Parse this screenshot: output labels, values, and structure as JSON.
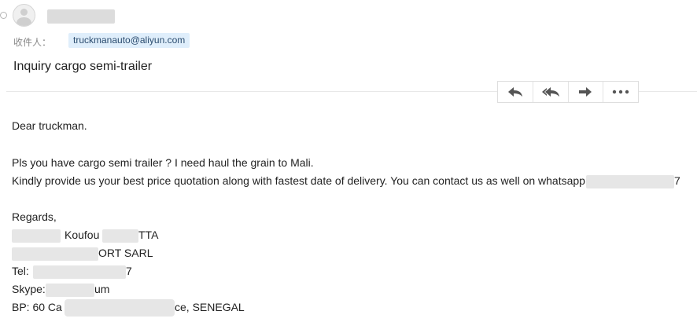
{
  "header": {
    "recipient_label": "收件人：",
    "recipient_email": "truckmanauto@aliyun.com"
  },
  "subject": "Inquiry cargo semi-trailer",
  "toolbar": {
    "reply_icon": "reply-icon",
    "reply_all_icon": "reply-all-icon",
    "forward_icon": "forward-icon",
    "more_icon": "more-icon"
  },
  "body": {
    "greeting": "Dear truckman.",
    "line1": "Pls you have cargo semi trailer ? I need haul the grain to Mali.",
    "line2": "Kindly provide us your best price quotation along with fastest date of delivery. You can contact us as well on whatsapp",
    "line2_end": "7",
    "regards": "Regards,",
    "sig_name_a": "Koufou",
    "sig_name_b": "TTA",
    "sig_company": "ORT SARL",
    "sig_tel_label": "Tel:",
    "sig_tel_end": "7",
    "sig_skype_label": "Skype:",
    "sig_skype_end": "um",
    "sig_bp_label": "BP: 60 Ca",
    "sig_bp_end": "ce, SENEGAL"
  }
}
